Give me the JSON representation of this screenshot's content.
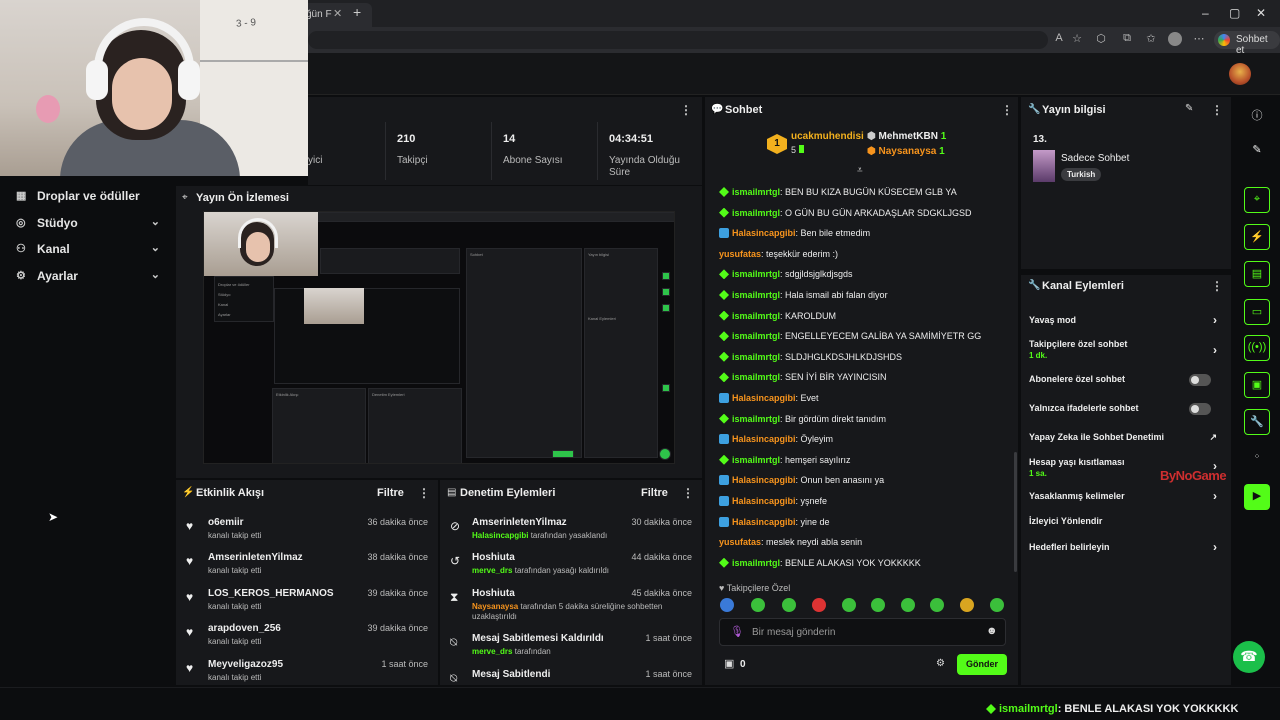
{
  "browser": {
    "tab_title": "ğün F",
    "sohbet_et": "Sohbet et"
  },
  "sidebar": {
    "items": [
      {
        "label": "Droplar ve ödüller",
        "icon": "gift-icon"
      },
      {
        "label": "Stüdyo",
        "icon": "studio-icon"
      },
      {
        "label": "Kanal",
        "icon": "users-icon"
      },
      {
        "label": "Ayarlar",
        "icon": "gear-icon"
      }
    ]
  },
  "stats": {
    "viewers_label": "yici",
    "followers_value": "210",
    "followers_label": "Takipçi",
    "subs_value": "14",
    "subs_label": "Abone Sayısı",
    "live_value": "04:34:51",
    "live_label": "Yayında Olduğu Süre"
  },
  "preview": {
    "title": "Yayın Ön İzlemesi"
  },
  "activity": {
    "title": "Etkinlik Akışı",
    "filter": "Filtre",
    "rows": [
      {
        "name": "o6emiir",
        "sub": "kanalı takip etti",
        "time": "36 dakika önce"
      },
      {
        "name": "AmserinletenYilmaz",
        "sub": "kanalı takip etti",
        "time": "38 dakika önce"
      },
      {
        "name": "LOS_KEROS_HERMANOS",
        "sub": "kanalı takip etti",
        "time": "39 dakika önce"
      },
      {
        "name": "arapdoven_256",
        "sub": "kanalı takip etti",
        "time": "39 dakika önce"
      },
      {
        "name": "Meyveligazoz95",
        "sub": "kanalı takip etti",
        "time": "1 saat önce"
      }
    ]
  },
  "moderation": {
    "title": "Denetim Eylemleri",
    "filter": "Filtre",
    "rows": [
      {
        "name": "AmserinletenYilmaz",
        "actor": "Halasincapgibi",
        "sub": "tarafından yasaklandı",
        "time": "30 dakika önce"
      },
      {
        "name": "Hoshiuta",
        "actor": "merve_drs",
        "sub": "tarafından yasağı kaldırıldı",
        "time": "44 dakika önce"
      },
      {
        "name": "Hoshiuta",
        "actor": "Naysanaysa",
        "sub": "tarafından 5 dakika süreliğine sohbetten uzaklaştırıldı",
        "time": "45 dakika önce"
      },
      {
        "name": "Mesaj Sabitlemesi Kaldırıldı",
        "actor": "merve_drs",
        "sub": "tarafından",
        "time": "1 saat önce"
      },
      {
        "name": "Mesaj Sabitlendi",
        "actor": "",
        "sub": "",
        "time": "1 saat önce"
      }
    ]
  },
  "chat": {
    "title": "Sohbet",
    "top_user": "ucakmuhendisi",
    "top_count": "5",
    "top_rank": "1",
    "mod1": "MehmetKBN",
    "mod1_count": "1",
    "mod2": "Naysanaysa",
    "mod2_count": "1",
    "messages": [
      {
        "user": "ismailmrtgl",
        "color": "green",
        "text": ": BEN BU KIZA BUGÜN KÜSECEM GLB YA"
      },
      {
        "user": "ismailmrtgl",
        "color": "green",
        "text": ": O GÜN BU GÜN ARKADAŞLAR SDGKLJGSD"
      },
      {
        "user": "Halasincapgibi",
        "color": "orange",
        "text": ": Ben bile etmedim"
      },
      {
        "user": "yusufatas",
        "color": "orange",
        "text": ": teşekkür ederim :)"
      },
      {
        "user": "ismailmrtgl",
        "color": "green",
        "text": ": sdgjldsjglkdjsgds"
      },
      {
        "user": "ismailmrtgl",
        "color": "green",
        "text": ": Hala ismail abi falan diyor"
      },
      {
        "user": "ismailmrtgl",
        "color": "green",
        "text": ": KAROLDUM"
      },
      {
        "user": "ismailmrtgl",
        "color": "green",
        "text": ": ENGELLEYECEM GALİBA YA SAMİMİYETR GG"
      },
      {
        "user": "ismailmrtgl",
        "color": "green",
        "text": ": SLDJHGLKDSJHLKDJSHDS"
      },
      {
        "user": "ismailmrtgl",
        "color": "green",
        "text": ": SEN İYİ BİR YAYINCISIN"
      },
      {
        "user": "Halasincapgibi",
        "color": "orange",
        "text": ": Evet"
      },
      {
        "user": "ismailmrtgl",
        "color": "green",
        "text": ": Bir gördüm direkt tanıdım"
      },
      {
        "user": "Halasincapgibi",
        "color": "orange",
        "text": ": Öyleyim"
      },
      {
        "user": "ismailmrtgl",
        "color": "green",
        "text": ": hemşeri sayılırız"
      },
      {
        "user": "Halasincapgibi",
        "color": "orange",
        "text": ": Onun ben anasını ya"
      },
      {
        "user": "Halasincapgibi",
        "color": "orange",
        "text": ": yşnefe"
      },
      {
        "user": "Halasincapgibi",
        "color": "orange",
        "text": ": yine de"
      },
      {
        "user": "yusufatas",
        "color": "orange",
        "text": ": meslek neydi abla senin"
      },
      {
        "user": "ismailmrtgl",
        "color": "green",
        "text": ": BENLE ALAKASI YOK YOKKKKK"
      }
    ],
    "followers_only": "Takipçilere Özel",
    "input_placeholder": "Bir mesaj gönderin",
    "points": "0",
    "send_label": "Gönder"
  },
  "stream_info": {
    "title": "Yayın bilgisi",
    "number": "13.",
    "category": "Sadece Sohbet",
    "tag": "Turkish"
  },
  "channel_actions": {
    "title": "Kanal Eylemleri",
    "items": [
      {
        "label": "Yavaş mod",
        "sub": "",
        "control": "chevron"
      },
      {
        "label": "Takipçilere özel sohbet",
        "sub": "1 dk.",
        "control": "chevron"
      },
      {
        "label": "Abonelere özel sohbet",
        "sub": "",
        "control": "toggle"
      },
      {
        "label": "Yalnızca ifadelerle sohbet",
        "sub": "",
        "control": "toggle"
      },
      {
        "label": "Yapay Zeka ile Sohbet Denetimi",
        "sub": "",
        "control": "external"
      },
      {
        "label": "Hesap yaşı kısıtlaması",
        "sub": "1 sa.",
        "control": "chevron"
      },
      {
        "label": "Yasaklanmış kelimeler",
        "sub": "",
        "control": "chevron"
      },
      {
        "label": "İzleyici Yönlendir",
        "sub": "",
        "control": "none"
      },
      {
        "label": "Hedefleri belirleyin",
        "sub": "",
        "control": "chevron"
      }
    ]
  },
  "watermark": "ByNoGame",
  "ticker": {
    "user": "ismailmrtgl",
    "text": ": BENLE ALAKASI YOK YOKKKKK"
  },
  "colors": {
    "accent": "#53fc18",
    "orange_user": "#f7941d",
    "panel": "#17181b",
    "background": "#0c0d0f"
  }
}
